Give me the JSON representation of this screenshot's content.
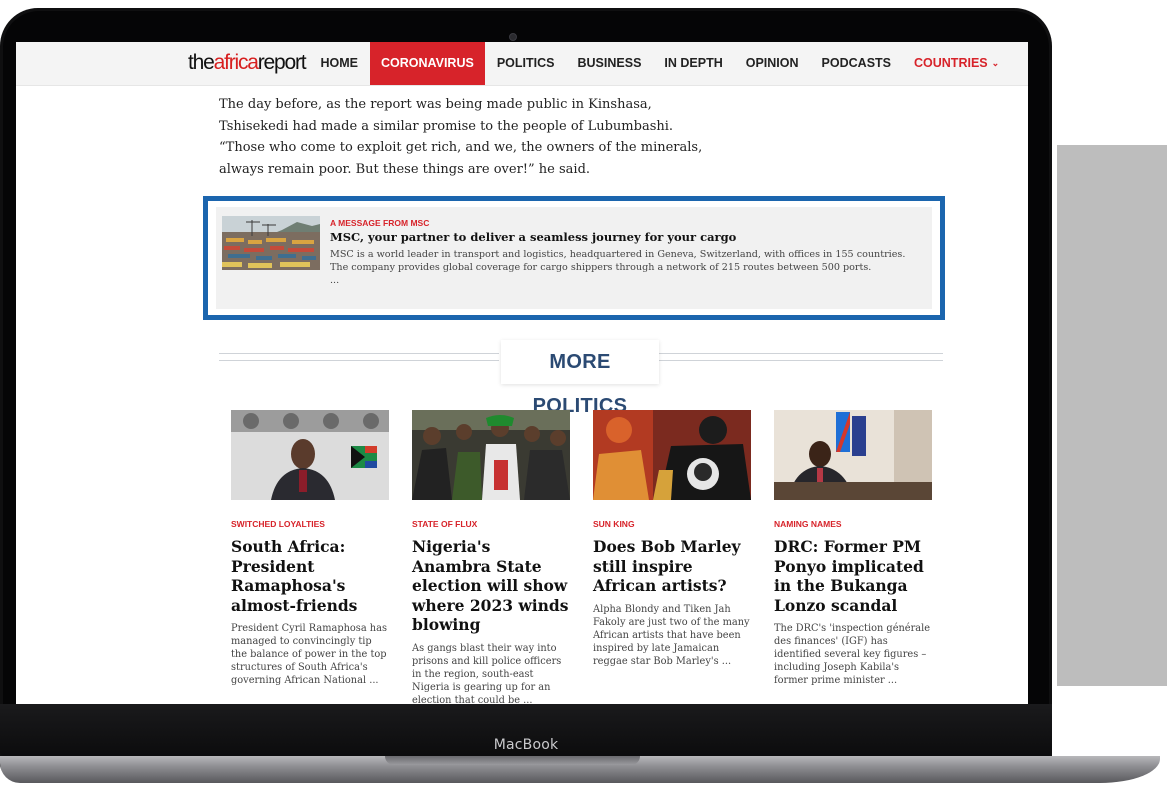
{
  "device": {
    "brand_label": "MacBook"
  },
  "site": {
    "logo_prefix": "the",
    "logo_accent": "africa",
    "logo_suffix": "report",
    "nav": [
      {
        "label": "HOME",
        "active": false
      },
      {
        "label": "CORONAVIRUS",
        "active": true
      },
      {
        "label": "POLITICS",
        "active": false
      },
      {
        "label": "BUSINESS",
        "active": false
      },
      {
        "label": "IN DEPTH",
        "active": false
      },
      {
        "label": "OPINION",
        "active": false
      },
      {
        "label": "PODCASTS",
        "active": false
      },
      {
        "label": "COUNTRIES",
        "active": false
      }
    ]
  },
  "article": {
    "paragraph": "The day before, as the report was being made public in Kinshasa, Tshisekedi had made a similar promise to the people of Lubumbashi. “Those who come to exploit get rich, and we, the owners of the minerals, always remain poor. But these things are over!” he said."
  },
  "sponsored": {
    "kicker": "A MESSAGE FROM MSC",
    "title": "MSC, your partner to deliver a seamless journey for your cargo",
    "body": "MSC is a world leader in transport and logistics, headquartered in Geneva, Switzerland, with offices in 155 countries. The company provides global coverage for cargo shippers through a network of 215 routes between 500 ports.",
    "ellipsis": "..."
  },
  "more_section": {
    "heading": "MORE POLITICS"
  },
  "cards": [
    {
      "kicker": "SWITCHED LOYALTIES",
      "title": "South Africa: President Ramaphosa's almost-friends",
      "body": "President Cyril Ramaphosa has managed to convincingly tip the balance of power in the top structures of South Africa's governing African National ..."
    },
    {
      "kicker": "STATE OF FLUX",
      "title": "Nigeria's Anambra State election will show where 2023 winds blowing",
      "body": "As gangs blast their way into prisons and kill police officers in the region, south-east Nigeria is gearing up for an election that could be ..."
    },
    {
      "kicker": "SUN KING",
      "title": "Does Bob Marley still inspire African artists?",
      "body": "Alpha Blondy and Tiken Jah Fakoly are just two of the many African artists that have been inspired by late Jamaican reggae star Bob Marley's ..."
    },
    {
      "kicker": "NAMING NAMES",
      "title": "DRC: Former PM Ponyo implicated in the Bukanga Lonzo scandal",
      "body": "The DRC's 'inspection générale des finances' (IGF) has identified several key figures – including Joseph Kabila's former prime minister ..."
    }
  ],
  "colors": {
    "brand_red": "#d7232a",
    "highlight_border": "#1b65ae",
    "section_heading": "#2b4a73"
  }
}
